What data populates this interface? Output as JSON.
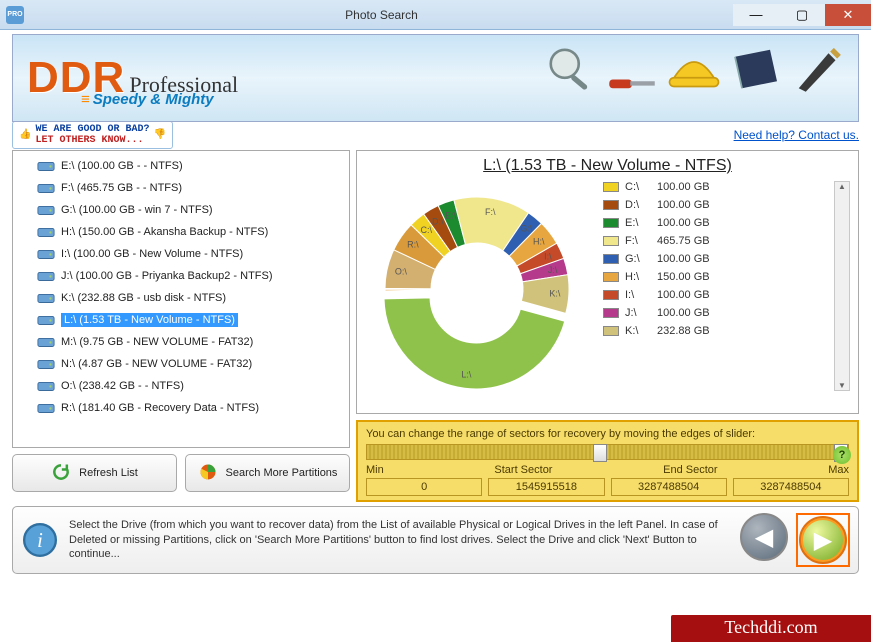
{
  "window": {
    "title": "Photo Search",
    "app_icon_text": "PRO"
  },
  "banner": {
    "brand": "DDR",
    "product": "Professional",
    "tagline": "Speedy & Mighty"
  },
  "feedback": {
    "line1": "WE ARE GOOD OR BAD?",
    "line2": "LET OTHERS KNOW..."
  },
  "help_link": "Need help? Contact us.",
  "drives": [
    {
      "label": "E:\\ (100.00 GB -  - NTFS)"
    },
    {
      "label": "F:\\ (465.75 GB -  - NTFS)"
    },
    {
      "label": "G:\\ (100.00 GB - win 7 - NTFS)"
    },
    {
      "label": "H:\\ (150.00 GB - Akansha Backup - NTFS)"
    },
    {
      "label": "I:\\ (100.00 GB - New Volume - NTFS)"
    },
    {
      "label": "J:\\ (100.00 GB - Priyanka Backup2 - NTFS)"
    },
    {
      "label": "K:\\ (232.88 GB - usb disk - NTFS)"
    },
    {
      "label": "L:\\ (1.53 TB - New Volume - NTFS)",
      "selected": true
    },
    {
      "label": "M:\\ (9.75 GB - NEW VOLUME - FAT32)"
    },
    {
      "label": "N:\\ (4.87 GB - NEW VOLUME - FAT32)"
    },
    {
      "label": "O:\\ (238.42 GB -  - NTFS)"
    },
    {
      "label": "R:\\ (181.40 GB - Recovery Data - NTFS)"
    }
  ],
  "buttons": {
    "refresh": "Refresh List",
    "search_more": "Search More Partitions"
  },
  "chart_title": "L:\\ (1.53 TB - New Volume - NTFS)",
  "legend": [
    {
      "color": "#f0d223",
      "label": "C:\\",
      "size": "100.00 GB"
    },
    {
      "color": "#a64b10",
      "label": "D:\\",
      "size": "100.00 GB"
    },
    {
      "color": "#1c8a2e",
      "label": "E:\\",
      "size": "100.00 GB"
    },
    {
      "color": "#f0e78c",
      "label": "F:\\",
      "size": "465.75 GB"
    },
    {
      "color": "#2e5fb0",
      "label": "G:\\",
      "size": "100.00 GB"
    },
    {
      "color": "#e7a640",
      "label": "H:\\",
      "size": "150.00 GB"
    },
    {
      "color": "#c44a2a",
      "label": "I:\\",
      "size": "100.00 GB"
    },
    {
      "color": "#b63a8c",
      "label": "J:\\",
      "size": "100.00 GB"
    },
    {
      "color": "#d0c27a",
      "label": "K:\\",
      "size": "232.88 GB"
    }
  ],
  "slider": {
    "desc": "You can change the range of sectors for recovery by moving the edges of slider:",
    "min_label": "Min",
    "start_label": "Start Sector",
    "end_label": "End Sector",
    "max_label": "Max",
    "min": "0",
    "start": "1545915518",
    "end": "3287488504",
    "max": "3287488504"
  },
  "footer_text": "Select the Drive (from which you want to recover data) from the List of available Physical or Logical Drives in the left Panel. In case of Deleted or missing Partitions, click on 'Search More Partitions' button to find lost drives. Select the Drive and click 'Next' Button to continue...",
  "watermark": "Techddi.com",
  "chart_data": {
    "type": "pie",
    "title": "L:\\ (1.53 TB - New Volume - NTFS)",
    "note": "Donut chart of drive partitions; L:\\ highlighted",
    "series": [
      {
        "name": "C:\\",
        "value": 100.0,
        "unit": "GB",
        "color": "#f0d223"
      },
      {
        "name": "D:\\",
        "value": 100.0,
        "unit": "GB",
        "color": "#a64b10"
      },
      {
        "name": "E:\\",
        "value": 100.0,
        "unit": "GB",
        "color": "#1c8a2e"
      },
      {
        "name": "F:\\",
        "value": 465.75,
        "unit": "GB",
        "color": "#f0e78c"
      },
      {
        "name": "G:\\",
        "value": 100.0,
        "unit": "GB",
        "color": "#2e5fb0"
      },
      {
        "name": "H:\\",
        "value": 150.0,
        "unit": "GB",
        "color": "#e7a640"
      },
      {
        "name": "I:\\",
        "value": 100.0,
        "unit": "GB",
        "color": "#c44a2a"
      },
      {
        "name": "J:\\",
        "value": 100.0,
        "unit": "GB",
        "color": "#b63a8c"
      },
      {
        "name": "K:\\",
        "value": 232.88,
        "unit": "GB",
        "color": "#d0c27a"
      },
      {
        "name": "L:\\",
        "value": 1566.72,
        "unit": "GB",
        "color": "#8fc24a",
        "highlighted": true
      },
      {
        "name": "M:\\",
        "value": 9.75,
        "unit": "GB",
        "color": "#e6a23c"
      },
      {
        "name": "N:\\",
        "value": 4.87,
        "unit": "GB",
        "color": "#c9b060"
      },
      {
        "name": "O:\\",
        "value": 238.42,
        "unit": "GB",
        "color": "#d4b070"
      },
      {
        "name": "R:\\",
        "value": 181.4,
        "unit": "GB",
        "color": "#d89a3a"
      }
    ]
  }
}
